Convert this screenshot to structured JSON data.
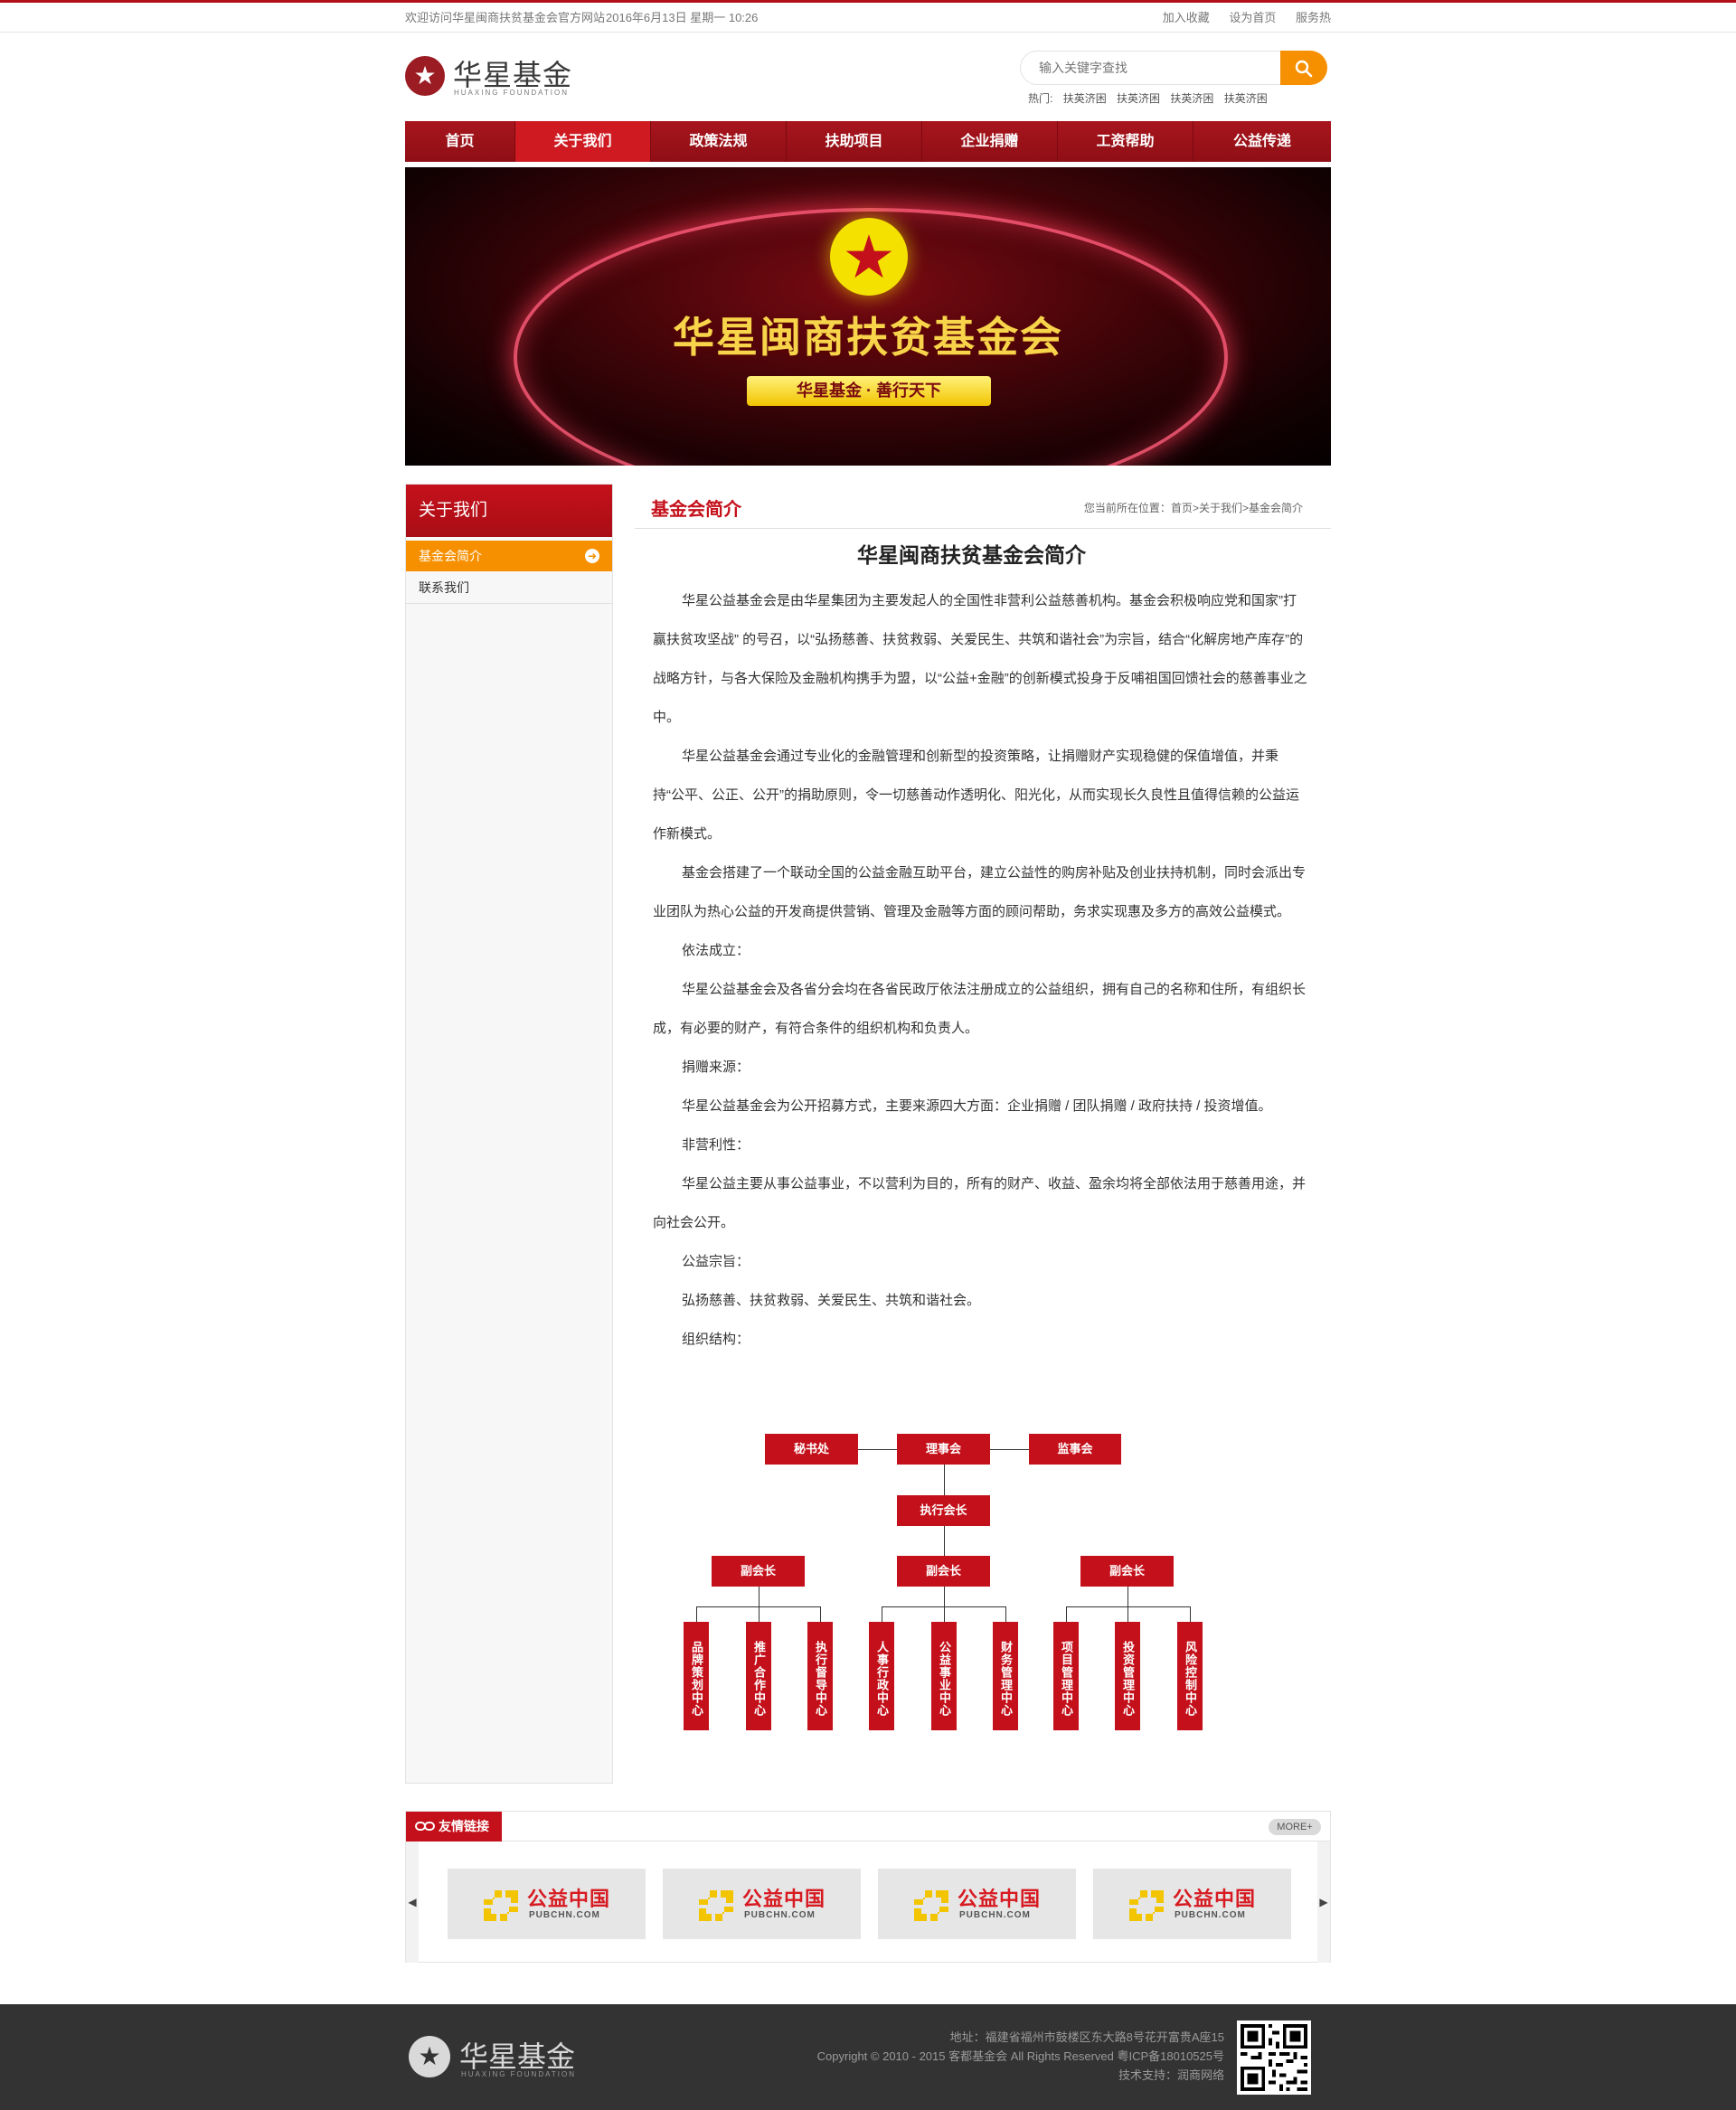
{
  "topbar": {
    "welcome": "欢迎访问华星闽商扶贫基金会官方网站",
    "datetime": "2016年6月13日 星期一 10:26",
    "links": [
      "加入收藏",
      "设为首页",
      "服务热"
    ]
  },
  "logo": {
    "name": "华星基金",
    "sub": "HUAXING FOUNDATION",
    "mark": "★"
  },
  "search": {
    "placeholder": "输入关键字查找",
    "hot_label": "热门:",
    "hot_words": [
      "扶英济困",
      "扶英济困",
      "扶英济困",
      "扶英济困"
    ]
  },
  "nav": {
    "items": [
      "首页",
      "关于我们",
      "政策法规",
      "扶助项目",
      "企业捐赠",
      "工资帮助",
      "公益传递"
    ],
    "active": "关于我们"
  },
  "banner": {
    "title": "华星闽商扶贫基金会",
    "slogan": "华星基金 · 善行天下",
    "emblem": "★"
  },
  "sidebar": {
    "title": "关于我们",
    "items": [
      "基金会简介",
      "联系我们"
    ],
    "arrow": "➜"
  },
  "content": {
    "section_title": "基金会简介",
    "breadcrumb": {
      "prefix": "您当前所在位置：",
      "home": "首页",
      "sep1": ">",
      "parent": "关于我们",
      "sep2": ">",
      "current": "基金会简介"
    },
    "article_title": "华星闽商扶贫基金会简介",
    "paragraphs": [
      "华星公益基金会是由华星集团为主要发起人的全国性非营利公益慈善机构。基金会积极响应党和国家”打赢扶贫攻坚战” 的号召，以“弘扬慈善、扶贫救弱、关爱民生、共筑和谐社会”为宗旨，结合“化解房地产库存”的战略方针，与各大保险及金融机构携手为盟，以“公益+金融”的创新模式投身于反哺祖国回馈社会的慈善事业之中。",
      "华星公益基金会通过专业化的金融管理和创新型的投资策略，让捐赠财产实现稳健的保值增值，并秉持“公平、公正、公开”的捐助原则，令一切慈善动作透明化、阳光化，从而实现长久良性且值得信赖的公益运作新模式。",
      "基金会搭建了一个联动全国的公益金融互助平台，建立公益性的购房补贴及创业扶持机制，同时会派出专业团队为热心公益的开发商提供营销、管理及金融等方面的顾问帮助，务求实现惠及多方的高效公益模式。",
      "依法成立：",
      "华星公益基金会及各省分会均在各省民政厅依法注册成立的公益组织，拥有自己的名称和住所，有组织长成，有必要的财产，有符合条件的组织机构和负责人。",
      "捐赠来源：",
      "华星公益基金会为公开招募方式，主要来源四大方面：企业捐赠 / 团队捐赠 / 政府扶持 / 投资增值。",
      "非营利性：",
      "华星公益主要从事公益事业，不以营利为目的，所有的财产、收益、盈余均将全部依法用于慈善用途，并向社会公开。",
      "公益宗旨：",
      "弘扬慈善、扶贫救弱、关爱民生、共筑和谐社会。",
      "组织结构："
    ]
  },
  "org_chart": {
    "top": [
      "秘书处",
      "理事会",
      "监事会"
    ],
    "executive": "执行会长",
    "vice": [
      "副会长",
      "副会长",
      "副会长"
    ],
    "centers": [
      [
        "品牌策划中心",
        "推广合作中心",
        "执行督导中心"
      ],
      [
        "人事行政中心",
        "公益事业中心",
        "财务管理中心"
      ],
      [
        "项目管理中心",
        "投资管理中心",
        "风险控制中心"
      ]
    ]
  },
  "friend_links": {
    "title": "友情链接",
    "more": "MORE+",
    "prev": "◀",
    "next": "▶",
    "items": [
      {
        "name": "公益中国",
        "url": "PUBCHN.COM"
      },
      {
        "name": "公益中国",
        "url": "PUBCHN.COM"
      },
      {
        "name": "公益中国",
        "url": "PUBCHN.COM"
      },
      {
        "name": "公益中国",
        "url": "PUBCHN.COM"
      }
    ]
  },
  "footer": {
    "logo_name": "华星基金",
    "logo_sub": "HUAXING FOUNDATION",
    "address": "地址：福建省福州市鼓楼区东大路8号花开富贵A座15",
    "copyright": "Copyright © 2010 - 2015 客都基金会 All Rights Reserved 粤ICP备18010525号",
    "support": "技术支持：润商网络"
  },
  "colors": {
    "brand_red": "#c4101a",
    "accent_orange": "#f69000",
    "footer_bg": "#333333"
  }
}
